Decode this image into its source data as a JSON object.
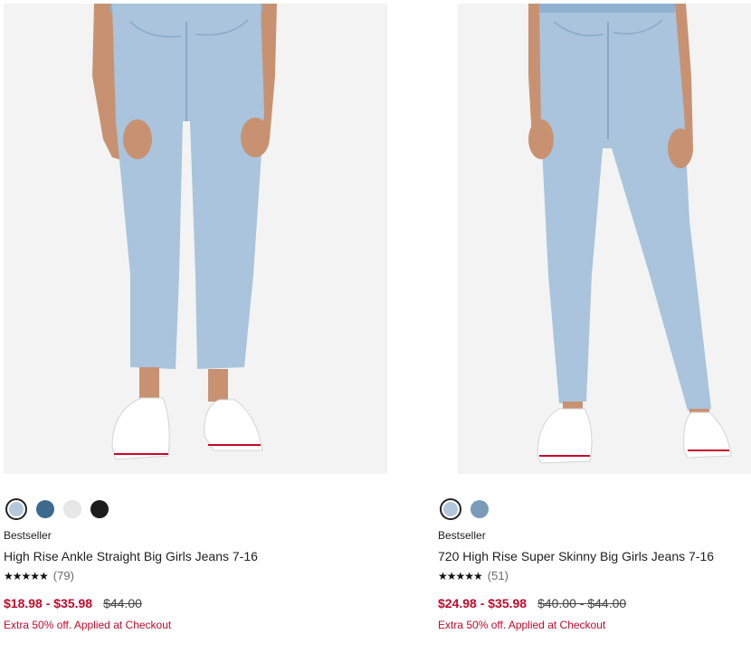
{
  "products": [
    {
      "image_alt": "High Rise Ankle Straight Big Girls Jeans 7-16",
      "swatches": [
        {
          "name": "light-wash",
          "color": "#b4c8dc",
          "selected": true
        },
        {
          "name": "medium-wash",
          "color": "#3d6a8c",
          "selected": false
        },
        {
          "name": "white",
          "color": "#e7e7e7",
          "selected": false
        },
        {
          "name": "black",
          "color": "#1c1c1c",
          "selected": false
        }
      ],
      "badge": "Bestseller",
      "title": "High Rise Ankle Straight Big Girls Jeans 7-16",
      "stars": "★★★★★",
      "rating_count": "(79)",
      "sale_price": "$18.98 - $35.98",
      "original_price": "$44.00",
      "promo": "Extra 50% off. Applied at Checkout"
    },
    {
      "image_alt": "720 High Rise Super Skinny Big Girls Jeans 7-16",
      "swatches": [
        {
          "name": "light-wash",
          "color": "#b4c8dc",
          "selected": true
        },
        {
          "name": "medium-wash",
          "color": "#7a9bb8",
          "selected": false
        }
      ],
      "badge": "Bestseller",
      "title": "720 High Rise Super Skinny Big Girls Jeans 7-16",
      "stars": "★★★★★",
      "rating_count": "(51)",
      "sale_price": "$24.98 - $35.98",
      "original_price": "$40.00 - $44.00",
      "promo": "Extra 50% off. Applied at Checkout"
    }
  ],
  "colors": {
    "sale_red": "#c4092a",
    "image_bg": "#f3f3f3",
    "denim_light": "#a9c4dc"
  }
}
